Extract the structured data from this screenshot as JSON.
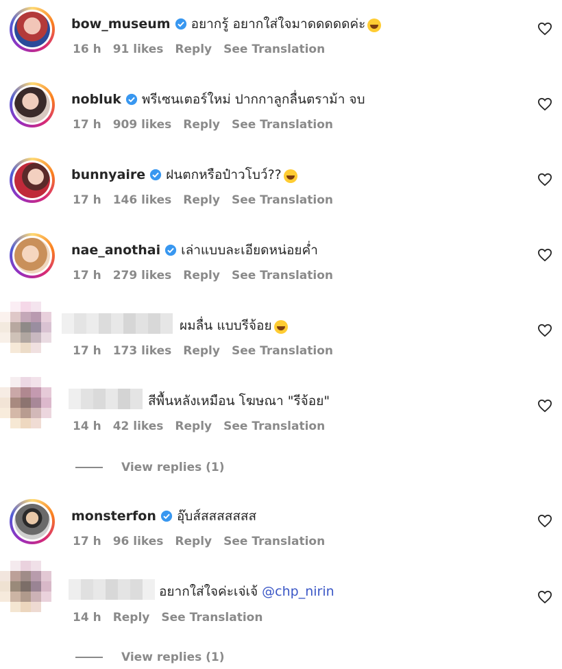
{
  "comments": [
    {
      "username": "bow_museum",
      "verified": true,
      "text": "อยากรู้ อยากใส่ใจมาดดดดดค่ะ",
      "emoji": true,
      "time": "16 h",
      "likes": "91 likes",
      "reply": "Reply",
      "translate": "See Translation"
    },
    {
      "username": "nobluk",
      "verified": true,
      "text": "พรีเซนเตอร์ใหม่ ปากกาลูกลื่นตราม้า จบ",
      "emoji": false,
      "time": "17 h",
      "likes": "909 likes",
      "reply": "Reply",
      "translate": "See Translation"
    },
    {
      "username": "bunnyaire",
      "verified": true,
      "text": "ฝนตกหรือป๋าวโบว์??",
      "emoji": true,
      "time": "17 h",
      "likes": "146 likes",
      "reply": "Reply",
      "translate": "See Translation"
    },
    {
      "username": "nae_anothai",
      "verified": true,
      "text": "เล่าแบบละเอียดหน่อยค่ำ",
      "emoji": false,
      "time": "17 h",
      "likes": "279 likes",
      "reply": "Reply",
      "translate": "See Translation"
    },
    {
      "username": "",
      "verified": false,
      "text": "ผมลื่น แบบรีจ้อย",
      "emoji": true,
      "time": "17 h",
      "likes": "173 likes",
      "reply": "Reply",
      "translate": "See Translation"
    },
    {
      "username": "",
      "verified": false,
      "text": "สีพื้นหลังเหมือน โฆษณา \"รีจ้อย\"",
      "emoji": false,
      "time": "14 h",
      "likes": "42 likes",
      "reply": "Reply",
      "translate": "See Translation",
      "view_replies": "View replies (1)"
    },
    {
      "username": "monsterfon",
      "verified": true,
      "text": "อุ๊บส์สสสสสสส",
      "emoji": false,
      "time": "17 h",
      "likes": "96 likes",
      "reply": "Reply",
      "translate": "See Translation"
    },
    {
      "username": "",
      "verified": false,
      "text": "อยากใส่ใจค่ะเจ่เจ้",
      "mention": "@chp_nirin",
      "emoji": false,
      "time": "14 h",
      "likes": "",
      "reply": "Reply",
      "translate": "See Translation",
      "view_replies": "View replies (1)"
    }
  ],
  "colors": {
    "verified": "#3897f0",
    "mention": "#3b57c6",
    "meta": "#8a8a8a"
  },
  "icons": {
    "like": "heart-icon",
    "verified": "verified-badge-icon"
  }
}
